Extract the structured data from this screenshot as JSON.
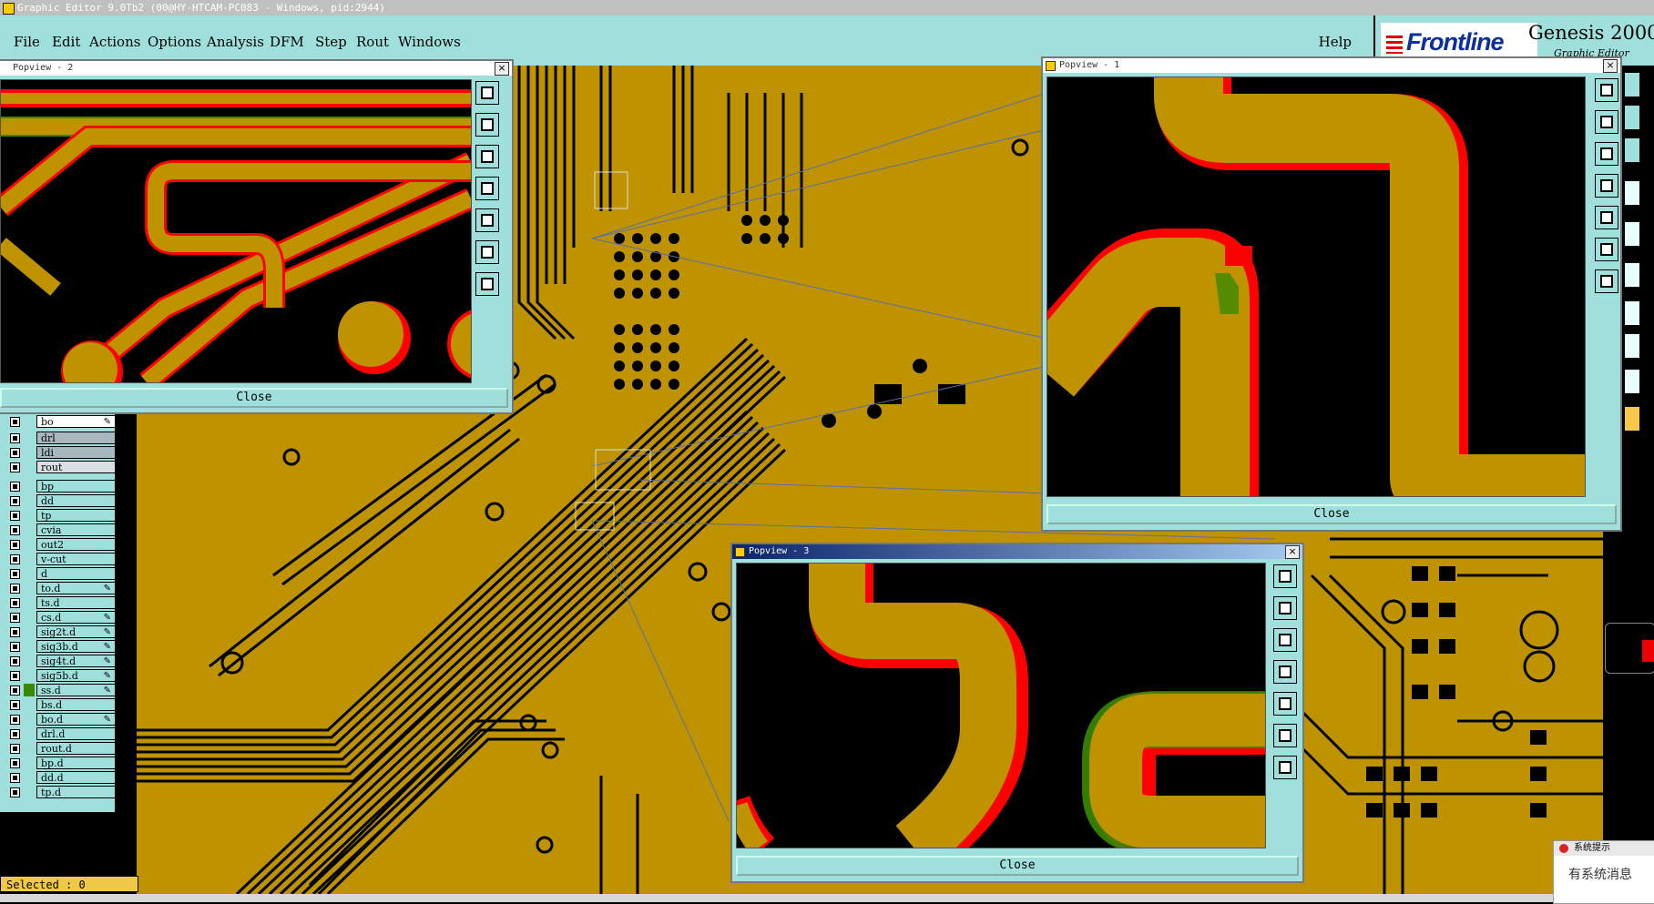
{
  "window": {
    "title": "Graphic Editor 9.0Tb2 (00@HY-HTCAM-PC083 - Windows, pid:2944)"
  },
  "menu": {
    "items": [
      "File",
      "Edit",
      "Actions",
      "Options",
      "Analysis",
      "DFM",
      "Step",
      "Rout",
      "Windows"
    ],
    "help": "Help"
  },
  "brand": {
    "logo": "Frontline",
    "product": "Genesis 2000",
    "subtitle": "Graphic Editor"
  },
  "layers": [
    {
      "name": "bo",
      "style": "white",
      "pen": true
    },
    {
      "name": "drl",
      "style": "grey",
      "pen": false
    },
    {
      "name": "ldi",
      "style": "grey",
      "pen": false
    },
    {
      "name": "rout",
      "style": "lightgrey",
      "pen": false
    },
    {
      "name": "bp",
      "style": "cyan",
      "pen": false
    },
    {
      "name": "dd",
      "style": "cyan",
      "pen": false
    },
    {
      "name": "tp",
      "style": "cyan",
      "pen": false
    },
    {
      "name": "cvia",
      "style": "cyan",
      "pen": false
    },
    {
      "name": "out2",
      "style": "cyan",
      "pen": false
    },
    {
      "name": "v-cut",
      "style": "cyan",
      "pen": false
    },
    {
      "name": "d",
      "style": "cyan",
      "pen": false
    },
    {
      "name": "to.d",
      "style": "cyan",
      "pen": true
    },
    {
      "name": "ts.d",
      "style": "cyan",
      "pen": false
    },
    {
      "name": "cs.d",
      "style": "cyan",
      "pen": true
    },
    {
      "name": "sig2t.d",
      "style": "cyan",
      "pen": true
    },
    {
      "name": "sig3b.d",
      "style": "cyan",
      "pen": true
    },
    {
      "name": "sig4t.d",
      "style": "cyan",
      "pen": true
    },
    {
      "name": "sig5b.d",
      "style": "cyan",
      "pen": true
    },
    {
      "name": "ss.d",
      "style": "cyan",
      "pen": true,
      "active": true
    },
    {
      "name": "bs.d",
      "style": "cyan",
      "pen": false
    },
    {
      "name": "bo.d",
      "style": "cyan",
      "pen": true
    },
    {
      "name": "drl.d",
      "style": "cyan",
      "pen": false
    },
    {
      "name": "rout.d",
      "style": "cyan",
      "pen": false
    },
    {
      "name": "bp.d",
      "style": "cyan",
      "pen": false
    },
    {
      "name": "dd.d",
      "style": "cyan",
      "pen": false
    },
    {
      "name": "tp.d",
      "style": "cyan",
      "pen": false
    }
  ],
  "status": {
    "selected": "Selected : 0"
  },
  "popviews": [
    {
      "title": "Popview - 2",
      "close": "Close"
    },
    {
      "title": "Popview - 1",
      "close": "Close"
    },
    {
      "title": "Popview - 3",
      "close": "Close"
    }
  ],
  "notification": {
    "title": "系统提示",
    "body": "有系统消息"
  },
  "colors": {
    "copper": "#bf9200",
    "board": "#000000",
    "highlight": "#ff0000",
    "compare": "#3a8a00",
    "panel": "#9fe0dc"
  }
}
